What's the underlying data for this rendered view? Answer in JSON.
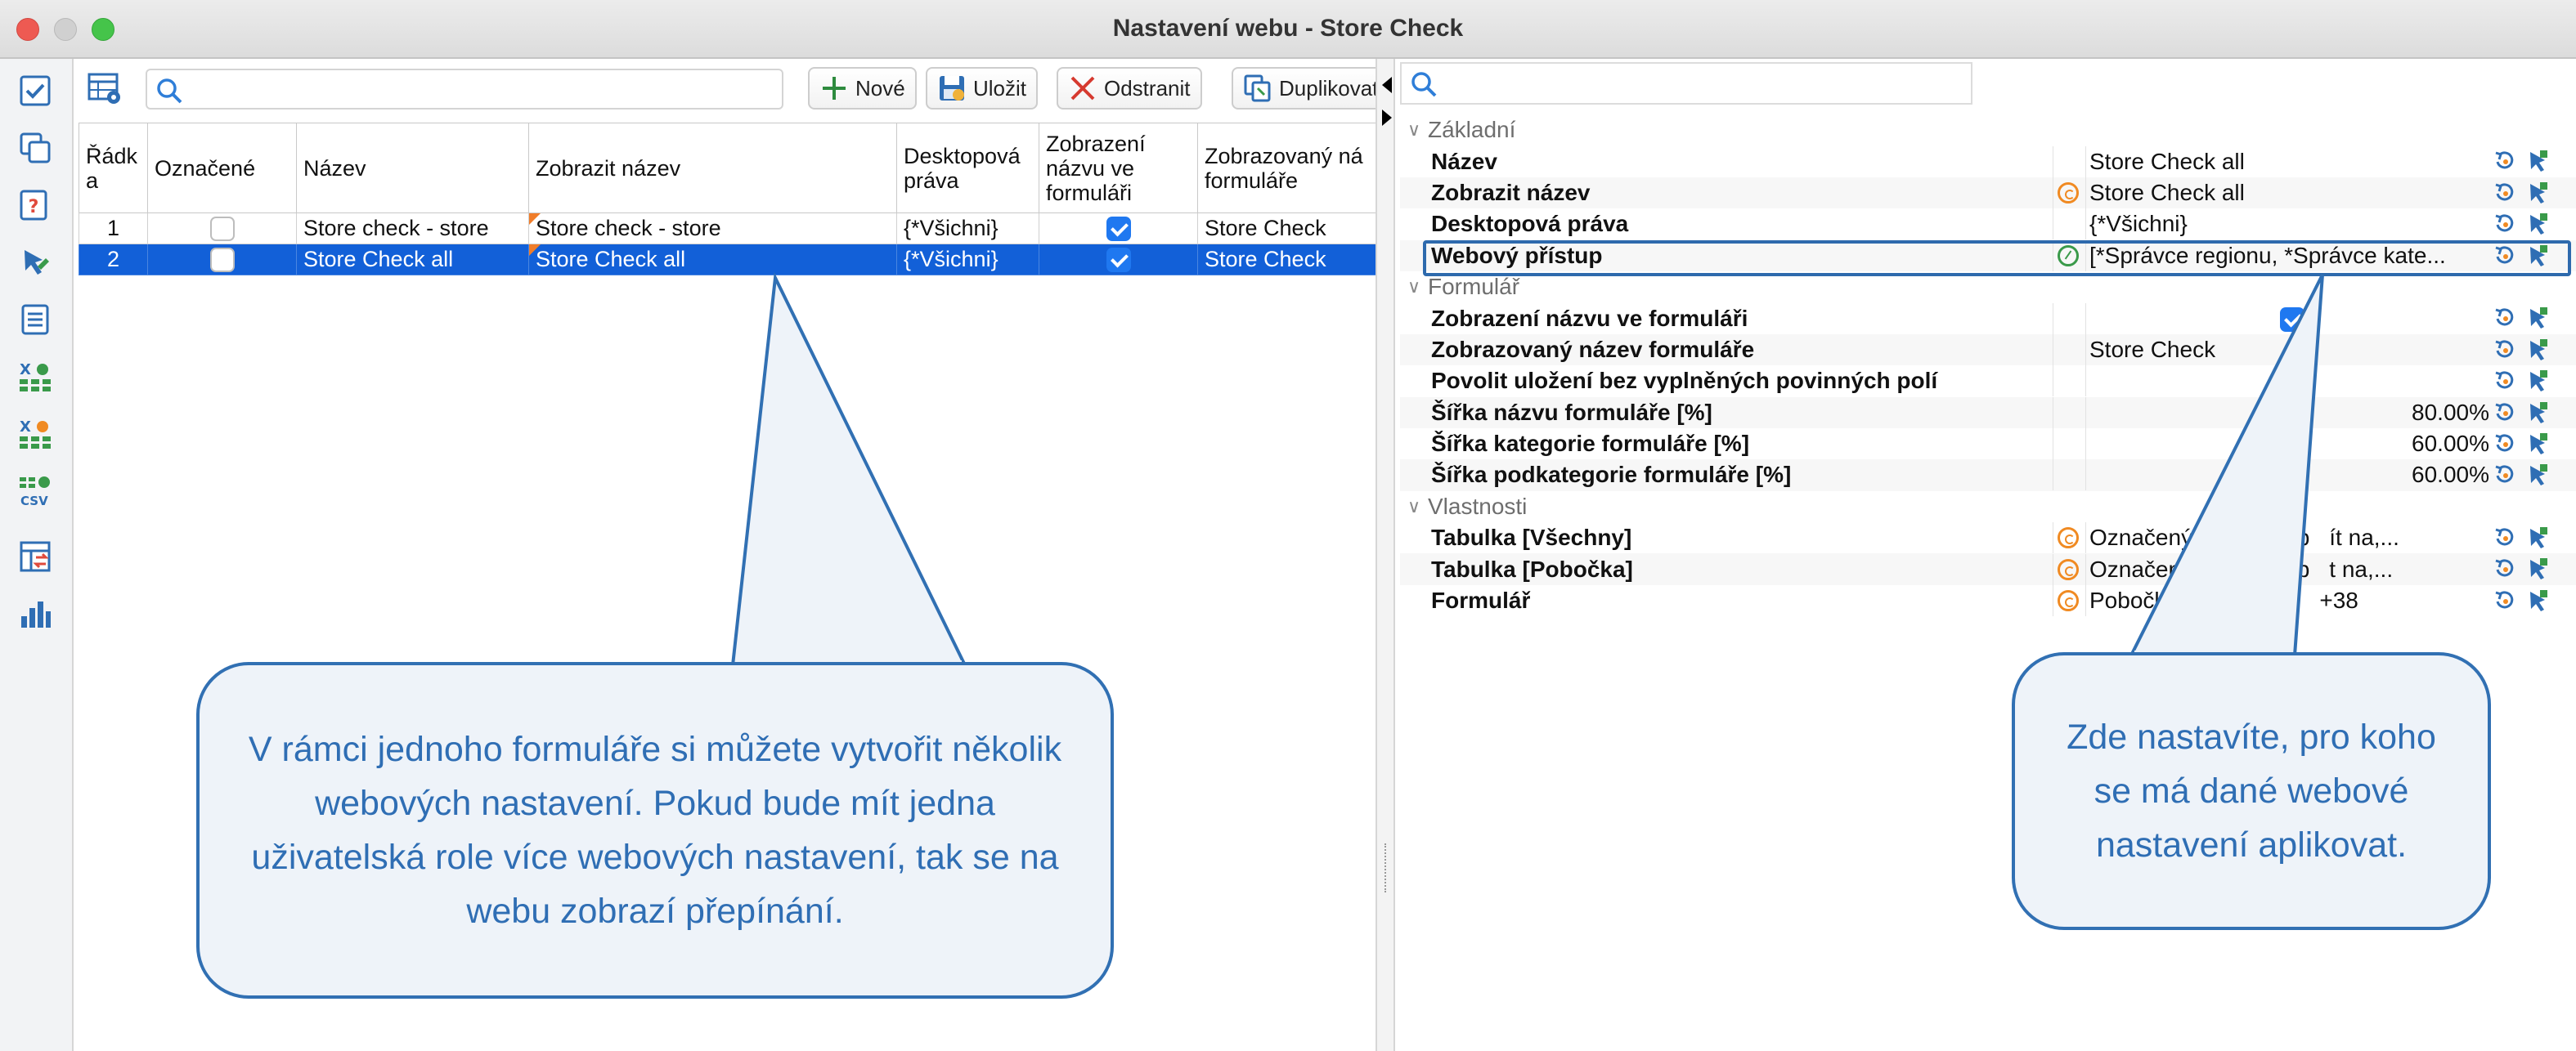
{
  "window": {
    "title": "Nastavení webu - Store Check"
  },
  "toolbar": {
    "search_placeholder": "",
    "new_label": "Nové",
    "save_label": "Uložit",
    "delete_label": "Odstranit",
    "duplicate_label": "Duplikovat"
  },
  "table": {
    "headers": [
      "Řádka",
      "Označené",
      "Název",
      "Zobrazit název",
      "Desktopová práva",
      "Zobrazení názvu ve formuláři",
      "Zobrazovaný název formuláře"
    ],
    "header_display": {
      "row": "Řádk a",
      "marked": "Označené",
      "name": "Název",
      "show_name": "Zobrazit název",
      "desktop_rights": "Desktopová práva",
      "form_name_display": "Zobrazení názvu ve formuláři",
      "form_display_name": "Zobrazovaný ná formuláře"
    },
    "rows": [
      {
        "num": "1",
        "name": "Store check - store",
        "show_name": "Store check - store",
        "rights": "{*Všichni}",
        "form_display_name": "Store Check",
        "marked": false,
        "name_in_form": true,
        "selected": false
      },
      {
        "num": "2",
        "name": "Store Check all",
        "show_name": "Store Check all",
        "rights": "{*Všichni}",
        "form_display_name": "Store Check",
        "marked": false,
        "name_in_form": true,
        "selected": true
      }
    ]
  },
  "properties": {
    "search_placeholder": "",
    "groups": [
      {
        "label": "Základní",
        "items": [
          {
            "name": "Název",
            "value": "Store Check all",
            "indicator": "",
            "align": "left"
          },
          {
            "name": "Zobrazit název",
            "value": "Store Check all",
            "indicator": "orange",
            "align": "left"
          },
          {
            "name": "Desktopová práva",
            "value": "{*Všichni}",
            "indicator": "",
            "align": "left"
          },
          {
            "name": "Webový přístup",
            "value": "[*Správce regionu, *Správce kate...",
            "indicator": "green",
            "align": "left"
          }
        ]
      },
      {
        "label": "Formulář",
        "items": [
          {
            "name": "Zobrazení názvu ve formuláři",
            "value": "",
            "indicator": "",
            "align": "center",
            "checkbox": true
          },
          {
            "name": "Zobrazovaný název formuláře",
            "value": "Store Check",
            "indicator": "",
            "align": "left"
          },
          {
            "name": "Povolit uložení bez vyplněných povinných polí",
            "value": "",
            "indicator": "",
            "align": "center",
            "checkbox": false
          },
          {
            "name": "Šířka názvu formuláře [%]",
            "value": "80.00%",
            "indicator": "",
            "align": "right"
          },
          {
            "name": "Šířka kategorie formuláře [%]",
            "value": "60.00%",
            "indicator": "",
            "align": "right"
          },
          {
            "name": "Šířka podkategorie formuláře [%]",
            "value": "60.00%",
            "indicator": "",
            "align": "right"
          }
        ]
      },
      {
        "label": "Vlastnosti",
        "items": [
          {
            "name": "Tabulka [Všechny]",
            "value": "Označený řádek, Pob",
            "value_tail": "ít na,...",
            "indicator": "orange",
            "align": "left"
          },
          {
            "name": "Tabulka [Pobočka]",
            "value": "Označený řádek, Pob",
            "value_tail": "t na,...",
            "indicator": "orange",
            "align": "left"
          },
          {
            "name": "Formulář",
            "value": "Pobočka, Vytvořeno,",
            "value_tail": "+38",
            "indicator": "orange",
            "align": "left"
          }
        ]
      }
    ]
  },
  "callouts": {
    "left": "V rámci jednoho formuláře si můžete vytvořit několik webových nastavení. Pokud bude mít jedna uživatelská role více webových nastavení, tak se na webu zobrazí přepínání.",
    "right": "Zde nastavíte, pro koho se má dané webové nastavení aplikovat."
  },
  "colors": {
    "selection": "#1260d8",
    "callout_border": "#3170b3",
    "callout_text": "#2f6eb4",
    "callout_bg": "#eef3f9"
  }
}
